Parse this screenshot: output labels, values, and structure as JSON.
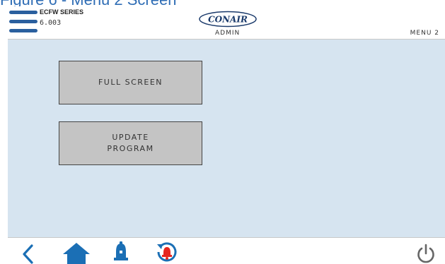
{
  "figure_caption": "Figure 6 - Menu 2 Screen",
  "header": {
    "model": "ECFW SERIES",
    "version": "6.003",
    "logo_text": "CONAIR",
    "role": "ADMIN",
    "menu_label": "MENU 2"
  },
  "buttons": {
    "full_screen": {
      "label": "FULL SCREEN"
    },
    "update_program": {
      "line1": "UPDATE",
      "line2": "PROGRAM"
    }
  },
  "footer": {
    "icons": [
      "back-icon",
      "home-icon",
      "bell-icon",
      "alarm-history-icon",
      "power-icon"
    ]
  },
  "colors": {
    "accent": "#2a5f9e",
    "content_bg": "#d6e4f0",
    "button_bg": "#c4c4c4",
    "icon_blue": "#1b6fb5",
    "alarm_red": "#e52620"
  }
}
